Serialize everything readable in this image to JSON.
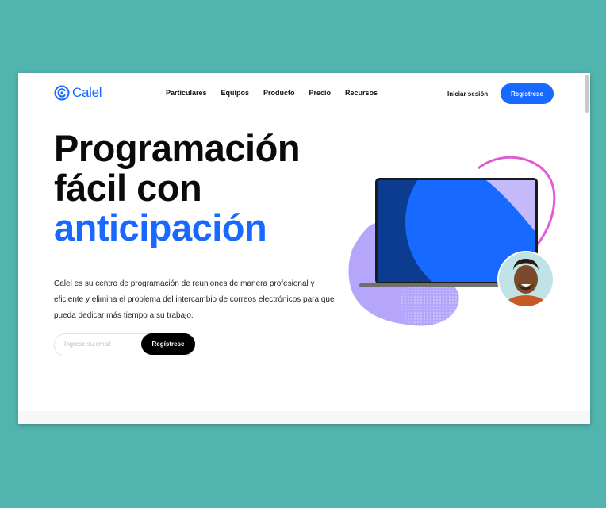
{
  "brand": {
    "name": "Calel",
    "color": "#1769ff"
  },
  "nav": {
    "items": [
      "Particulares",
      "Equipos",
      "Producto",
      "Precio",
      "Recursos"
    ]
  },
  "header": {
    "signin_label": "Iniciar sesión",
    "signup_label": "Regístrese"
  },
  "hero": {
    "headline_line1": "Programación",
    "headline_line2": "fácil con",
    "headline_accent": "anticipación",
    "description": "Calel es su centro de programación de reuniones de manera profesional y eficiente y elimina el problema del intercambio de correos electrónicos para que pueda dedicar más tiempo a su trabajo.",
    "email_placeholder": "Ingrese su email",
    "form_button_label": "Regístrese"
  },
  "colors": {
    "background": "#52b4ae",
    "accent": "#1769ff",
    "blob": "#b5a6fb",
    "outline": "#e05ad6"
  },
  "icons": {
    "logo": "calendar-c-icon",
    "avatar": "user-avatar"
  }
}
